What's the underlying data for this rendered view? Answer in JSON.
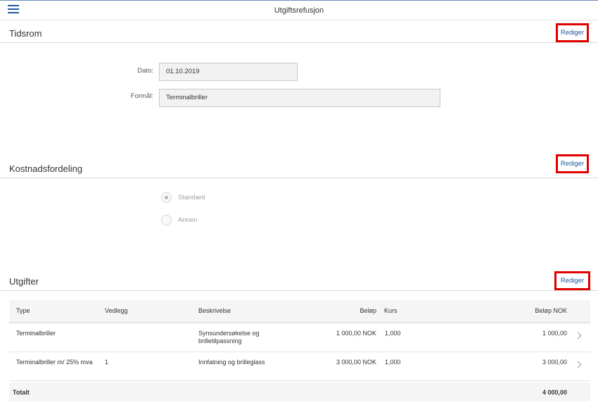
{
  "app": {
    "title": "Utgiftsrefusjon"
  },
  "sections": {
    "tidsrom": {
      "title": "Tidsrom",
      "edit_label": "Rediger"
    },
    "kostnad": {
      "title": "Kostnadsfordeling",
      "edit_label": "Rediger"
    },
    "utgifter": {
      "title": "Utgifter",
      "edit_label": "Rediger"
    }
  },
  "form": {
    "dato_label": "Dato:",
    "dato_value": "01.10.2019",
    "formal_label": "Formål:",
    "formal_value": "Terminalbriller"
  },
  "kostnadsfordeling": {
    "options": [
      {
        "label": "Standard",
        "selected": true
      },
      {
        "label": "Annen",
        "selected": false
      }
    ]
  },
  "table": {
    "headers": {
      "type": "Type",
      "vedlegg": "Vedlegg",
      "beskrivelse": "Beskrivelse",
      "belop": "Beløp",
      "kurs": "Kurs",
      "belop_nok": "Beløp NOK"
    },
    "rows": [
      {
        "type": "Terminalbriller",
        "vedlegg": "",
        "beskrivelse_line1": "Synsundersøkelse og",
        "beskrivelse_line2": "brilletilpassning",
        "belop": "1 000,00 NOK",
        "kurs": "1,000",
        "belop_nok": "1 000,00"
      },
      {
        "type": "Terminalbriller m/ 25% mva",
        "vedlegg": "1",
        "beskrivelse_line1": "Innfatning og brilleglass",
        "beskrivelse_line2": "",
        "belop": "3 000,00 NOK",
        "kurs": "1,000",
        "belop_nok": "3 000,00"
      }
    ],
    "total_label": "Totalt",
    "total_value": "4 000,00"
  }
}
